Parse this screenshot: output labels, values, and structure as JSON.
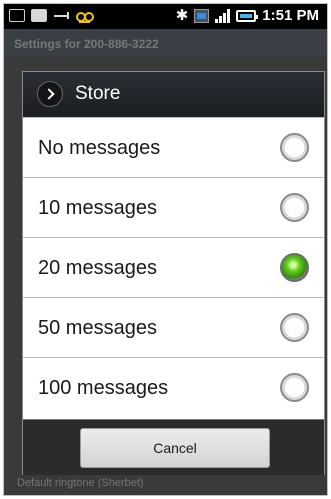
{
  "status_bar": {
    "time": "1:51 PM",
    "bluetooth_glyph": "✱",
    "icons": [
      "message-icon",
      "ink-icon",
      "usb-icon",
      "voicemail-icon",
      "bluetooth-icon",
      "network-icon",
      "signal-icon",
      "battery-icon"
    ]
  },
  "background": {
    "title": "Settings for 200-886-3222",
    "bottom_text": "Default ringtone (Sherbet)"
  },
  "dialog": {
    "title": "Store",
    "options": [
      {
        "label": "No messages",
        "selected": false
      },
      {
        "label": "10 messages",
        "selected": false
      },
      {
        "label": "20 messages",
        "selected": true
      },
      {
        "label": "50 messages",
        "selected": false
      },
      {
        "label": "100 messages",
        "selected": false
      }
    ],
    "cancel_label": "Cancel"
  },
  "colors": {
    "dialog_header": "#1f2329",
    "selected_radio": "#53c21a"
  }
}
